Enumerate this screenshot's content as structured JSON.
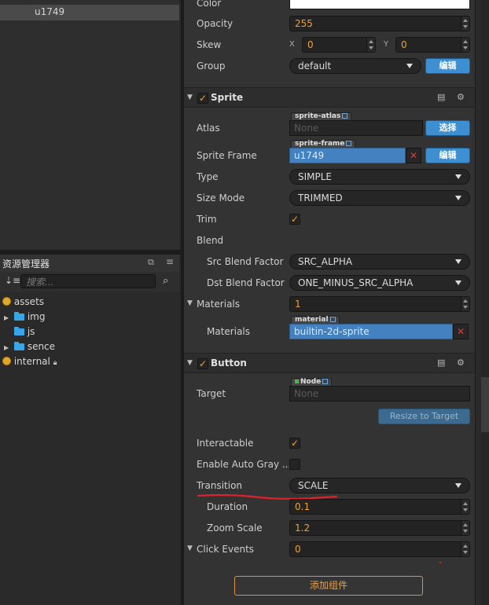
{
  "hierarchy": {
    "selected_item": "u1749"
  },
  "assets_panel": {
    "title": "资源管理器",
    "search_placeholder": "搜索...",
    "tree": [
      {
        "label": "assets",
        "type": "db"
      },
      {
        "label": "img",
        "type": "folder"
      },
      {
        "label": "js",
        "type": "folder"
      },
      {
        "label": "sence",
        "type": "folder"
      },
      {
        "label": "internal",
        "type": "db"
      }
    ]
  },
  "node": {
    "color_label": "Color",
    "opacity_label": "Opacity",
    "opacity_value": "255",
    "skew_label": "Skew",
    "skew_x_label": "X",
    "skew_x": "0",
    "skew_y_label": "Y",
    "skew_y": "0",
    "group_label": "Group",
    "group_value": "default",
    "group_edit": "编辑"
  },
  "sprite": {
    "title": "Sprite",
    "atlas_label": "Atlas",
    "atlas_tag": "sprite-atlas",
    "atlas_value": "None",
    "atlas_button": "选择",
    "frame_label": "Sprite Frame",
    "frame_tag": "sprite-frame",
    "frame_value": "u1749",
    "frame_edit": "编辑",
    "type_label": "Type",
    "type_value": "SIMPLE",
    "sizemode_label": "Size Mode",
    "sizemode_value": "TRIMMED",
    "trim_label": "Trim",
    "blend_label": "Blend",
    "src_label": "Src Blend Factor",
    "src_value": "SRC_ALPHA",
    "dst_label": "Dst Blend Factor",
    "dst_value": "ONE_MINUS_SRC_ALPHA",
    "materials_label": "Materials",
    "materials_count": "1",
    "materials_item_label": "Materials",
    "material_tag": "material",
    "material_value": "builtin-2d-sprite"
  },
  "button": {
    "title": "Button",
    "target_label": "Target",
    "target_tag": "Node",
    "target_value": "None",
    "resize_button": "Resize to Target",
    "interactable_label": "Interactable",
    "autogray_label": "Enable Auto Gray ...",
    "transition_label": "Transition",
    "transition_value": "SCALE",
    "duration_label": "Duration",
    "duration_value": "0.1",
    "zoom_label": "Zoom Scale",
    "zoom_value": "1.2",
    "events_label": "Click Events",
    "events_value": "0"
  },
  "add_component": "添加组件",
  "colors": {
    "accent": "#3d8fd1",
    "value_orange": "#e8a33d",
    "annotation_red": "#e0202a"
  }
}
